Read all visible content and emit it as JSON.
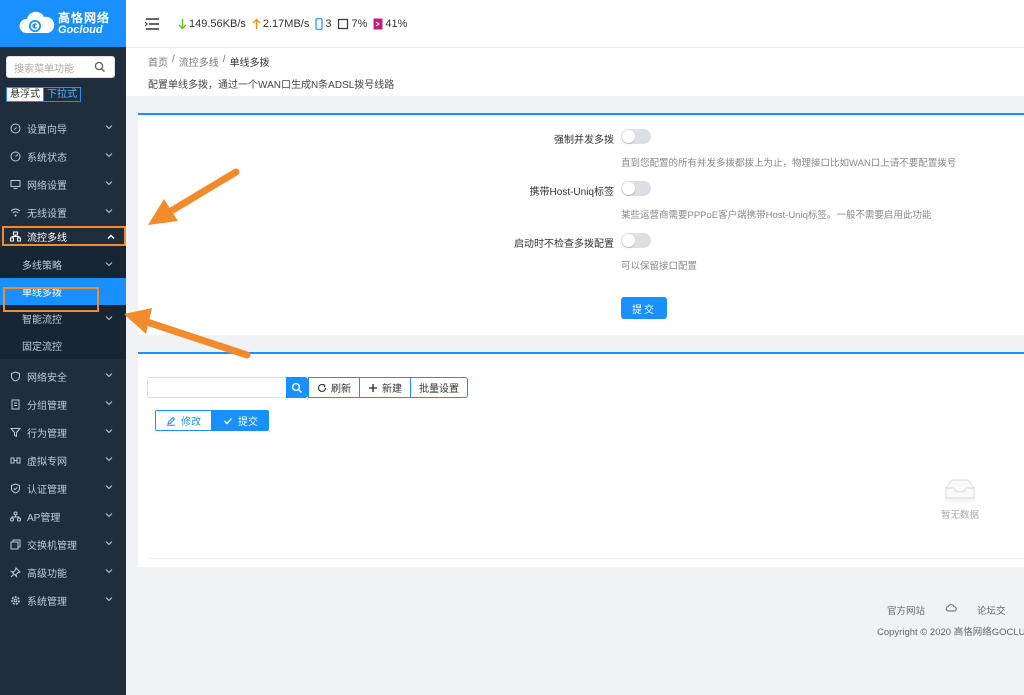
{
  "brand": {
    "name_cn": "高恪网络",
    "name_en": "Gocloud"
  },
  "sidebar": {
    "search_placeholder": "搜索菜单功能",
    "mode_options": [
      "悬浮式",
      "下拉式"
    ],
    "items": [
      {
        "label": "设置向导",
        "icon": "compass-icon"
      },
      {
        "label": "系统状态",
        "icon": "dashboard-icon"
      },
      {
        "label": "网络设置",
        "icon": "monitor-icon"
      },
      {
        "label": "无线设置",
        "icon": "wifi-icon"
      },
      {
        "label": "流控多线",
        "icon": "network-icon"
      },
      {
        "label": "网络安全",
        "icon": "shield-icon"
      },
      {
        "label": "分组管理",
        "icon": "group-icon"
      },
      {
        "label": "行为管理",
        "icon": "filter-icon"
      },
      {
        "label": "虚拟专网",
        "icon": "vpn-icon"
      },
      {
        "label": "认证管理",
        "icon": "check-shield-icon"
      },
      {
        "label": "AP管理",
        "icon": "ap-icon"
      },
      {
        "label": "交换机管理",
        "icon": "switch-icon"
      },
      {
        "label": "高级功能",
        "icon": "pin-icon"
      },
      {
        "label": "系统管理",
        "icon": "gear-icon"
      }
    ],
    "submenu": [
      {
        "label": "多线策略"
      },
      {
        "label": "单线多拨"
      },
      {
        "label": "智能流控"
      },
      {
        "label": "固定流控"
      }
    ]
  },
  "topbar": {
    "download": "149.56KB/s",
    "upload": "2.17MB/s",
    "devices": "3",
    "cpu": "7%",
    "memory": "41%"
  },
  "breadcrumb": {
    "items": [
      "首页",
      "/",
      "流控多线",
      "/",
      "单线多拨"
    ],
    "description": "配置单线多拨，通过一个WAN口生成N条ADSL拨号线路"
  },
  "settings": [
    {
      "label": "强制并发多拨",
      "hint": "直到您配置的所有并发多拨都拨上为止，物理接口比如WAN口上请不要配置拨号",
      "enabled": false
    },
    {
      "label": "携带Host-Uniq标签",
      "hint": "某些运营商需要PPPoE客户端携带Host-Uniq标签。一般不需要启用此功能",
      "enabled": false
    },
    {
      "label": "启动时不检查多拨配置",
      "hint": "可以保留接口配置",
      "enabled": false
    }
  ],
  "submit_label": "提交",
  "toolbar": {
    "search_value": "",
    "refresh_label": "刷新",
    "new_label": "新建",
    "batch_label": "批量设置",
    "edit_label": "修改",
    "commit_label": "提交"
  },
  "empty_text": "暂无数据",
  "footer": {
    "links": [
      "官方网站",
      "论坛交"
    ],
    "copyright": "Copyright © 2020 高恪网络GOCLU"
  },
  "colors": {
    "primary": "#1890ff",
    "sidebar": "#1f2d3d",
    "annotation": "#f28b2c"
  }
}
